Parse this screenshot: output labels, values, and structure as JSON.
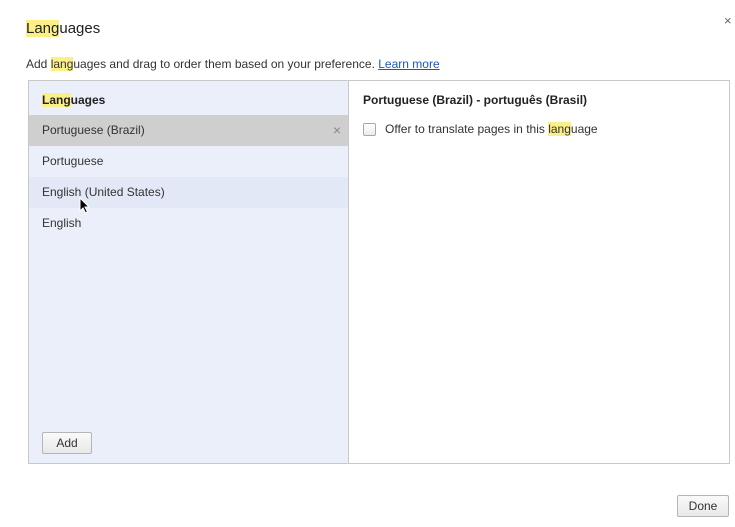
{
  "dialog": {
    "title_highlight": "Lang",
    "title_rest": "uages",
    "close_glyph": "×",
    "description": {
      "prefix": "Add ",
      "highlight": "lang",
      "suffix": "uages and drag to order them based on your preference. ",
      "link": "Learn more"
    }
  },
  "left_panel": {
    "header_highlight": "Lang",
    "header_rest": "uages",
    "items": [
      {
        "label": "Portuguese (Brazil)",
        "selected": true,
        "remove_glyph": "×"
      },
      {
        "label": "Portuguese"
      },
      {
        "label": "English (United States)",
        "hover": true
      },
      {
        "label": "English"
      }
    ],
    "add_label": "Add"
  },
  "right_panel": {
    "header": "Portuguese (Brazil) - português (Brasil)",
    "checkbox": {
      "prefix": "Offer to translate pages in this ",
      "highlight": "lang",
      "suffix": "uage",
      "checked": false
    }
  },
  "footer": {
    "done_label": "Done"
  },
  "colors": {
    "highlight": "#fbf087",
    "link": "#1a55c4",
    "list_background": "#ebeffa",
    "selected_row": "#cfcfcf"
  }
}
